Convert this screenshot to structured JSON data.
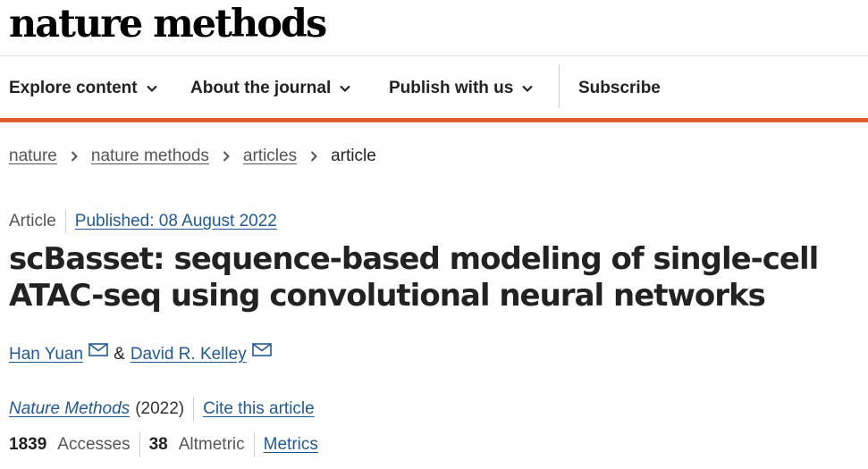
{
  "site": {
    "logo_text": "nature methods"
  },
  "nav": {
    "items": [
      {
        "label": "Explore content"
      },
      {
        "label": "About the journal"
      },
      {
        "label": "Publish with us"
      }
    ],
    "subscribe_label": "Subscribe"
  },
  "breadcrumb": [
    "nature",
    "nature methods",
    "articles",
    "article"
  ],
  "article": {
    "type": "Article",
    "published": "Published: 08 August 2022",
    "title": "scBasset: sequence-based modeling of single-cell ATAC-seq using convolutional neural networks",
    "authors": [
      "Han Yuan",
      "David R. Kelley"
    ],
    "author_separator": "&",
    "journal": "Nature Methods",
    "year": "(2022)",
    "cite_label": "Cite this article",
    "accesses_count": "1839",
    "accesses_label": "Accesses",
    "altmetric_count": "38",
    "altmetric_label": "Altmetric",
    "metrics_label": "Metrics"
  },
  "colors": {
    "accent": "#e05a2b",
    "link": "#1f5a96"
  },
  "icons": {
    "chevron": "chevron-down-icon",
    "crumb_sep": "chevron-right-icon",
    "mail": "mail-icon"
  }
}
